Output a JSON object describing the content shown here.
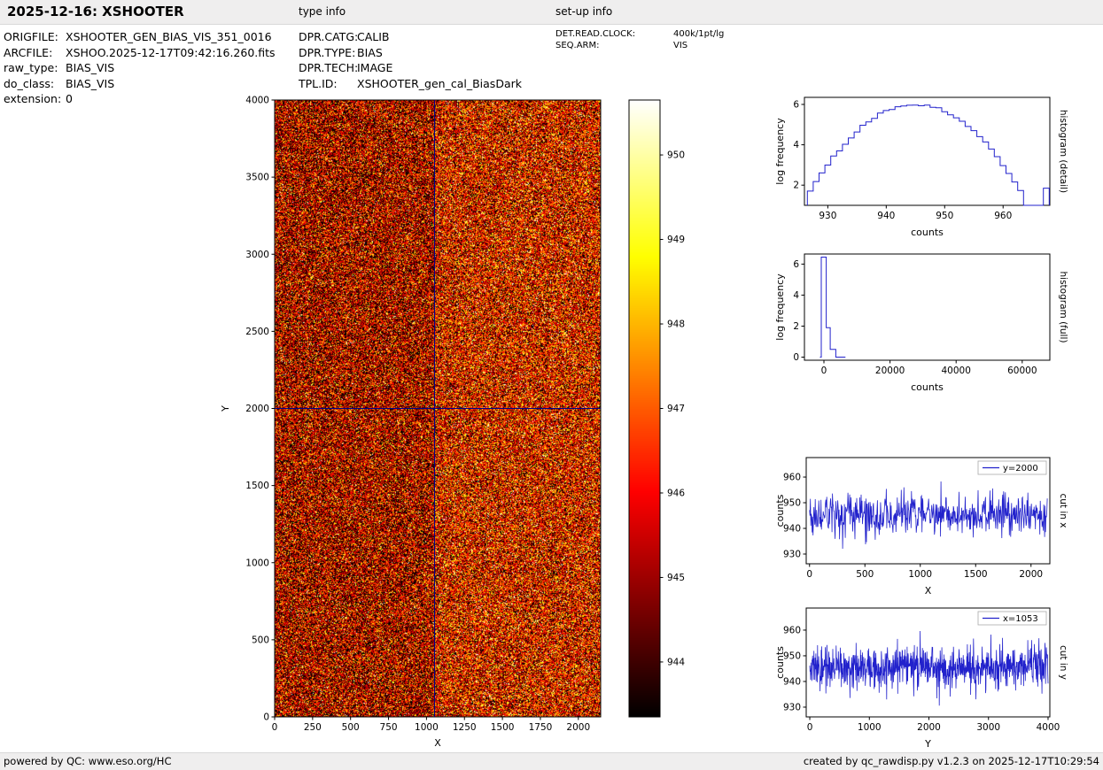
{
  "header": {
    "title": "2025-12-16: XSHOOTER",
    "type_info_label": "type info",
    "setup_info_label": "set-up info"
  },
  "file_info": {
    "rows": [
      {
        "label": "ORIGFILE:",
        "value": "XSHOOTER_GEN_BIAS_VIS_351_0016"
      },
      {
        "label": "ARCFILE:",
        "value": "XSHOO.2025-12-17T09:42:16.260.fits"
      },
      {
        "label": "raw_type:",
        "value": "BIAS_VIS"
      },
      {
        "label": "do_class:",
        "value": "BIAS_VIS"
      },
      {
        "label": "extension:",
        "value": "0"
      }
    ]
  },
  "type_info": {
    "rows": [
      {
        "label": "DPR.CATG:",
        "value": "CALIB"
      },
      {
        "label": "DPR.TYPE:",
        "value": "BIAS"
      },
      {
        "label": "DPR.TECH:",
        "value": "IMAGE"
      },
      {
        "label": "TPL.ID:",
        "value": "XSHOOTER_gen_cal_BiasDark"
      }
    ]
  },
  "setup_info": {
    "rows": [
      {
        "label": "DET.READ.CLOCK:",
        "value": "400k/1pt/lg"
      },
      {
        "label": "SEQ.ARM:",
        "value": "VIS"
      }
    ]
  },
  "footer": {
    "left_prefix": "powered by QC: ",
    "left_link": "www.eso.org/HC",
    "right": "created by qc_rawdisp.py v1.2.3 on 2025-12-17T10:29:54"
  },
  "chart_data": [
    {
      "id": "bias_image",
      "type": "heatmap",
      "xlabel": "X",
      "ylabel": "Y",
      "xlim": [
        0,
        2147
      ],
      "ylim": [
        0,
        4000
      ],
      "xticks": [
        0,
        250,
        500,
        750,
        1000,
        1250,
        1500,
        1750,
        2000
      ],
      "yticks": [
        0,
        500,
        1000,
        1500,
        2000,
        2500,
        3000,
        3500,
        4000
      ],
      "colormap": "hot",
      "mean_counts": 945.5,
      "sigma_counts": 2.0,
      "crosshair_x": 1053,
      "crosshair_y": 2000,
      "crosshair_color": "#00008b",
      "colorbar": {
        "ticks": [
          944,
          945,
          946,
          947,
          948,
          949,
          950
        ],
        "vmin": 943.35,
        "vmax": 950.65
      }
    },
    {
      "id": "histogram_detail",
      "type": "step-histogram",
      "xlabel": "counts",
      "ylabel": "log frequency",
      "side_label": "histogram (detail)",
      "xlim": [
        926,
        968
      ],
      "ylim": [
        1,
        6.35
      ],
      "xticks": [
        930,
        940,
        950,
        960
      ],
      "yticks": [
        2,
        4,
        6
      ],
      "peak": {
        "x": 945,
        "log_freq": 6
      },
      "sigma": 4.04,
      "bin_width": 1,
      "line_color": "#2222cc"
    },
    {
      "id": "histogram_full",
      "type": "step-histogram",
      "xlabel": "counts",
      "ylabel": "log frequency",
      "side_label": "histogram (full)",
      "xlim": [
        -5900,
        68360
      ],
      "ylim": [
        -0.2,
        6.65
      ],
      "xticks": [
        0,
        20000,
        40000,
        60000
      ],
      "yticks": [
        0,
        2,
        4,
        6
      ],
      "path": [
        [
          -1200,
          0
        ],
        [
          -800,
          0
        ],
        [
          -800,
          6.45
        ],
        [
          700,
          6.45
        ],
        [
          700,
          1.9
        ],
        [
          1900,
          1.9
        ],
        [
          1900,
          0.5
        ],
        [
          3600,
          0.5
        ],
        [
          3600,
          0
        ],
        [
          6500,
          0
        ]
      ],
      "line_color": "#2222cc"
    },
    {
      "id": "cut_in_x",
      "type": "line",
      "legend": "y=2000",
      "side_label": "cut in x",
      "xlabel": "X",
      "ylabel": "counts",
      "xlim": [
        -30,
        2170
      ],
      "ylim": [
        926.2,
        967.6
      ],
      "xticks": [
        0,
        500,
        1000,
        1500,
        2000
      ],
      "yticks": [
        930,
        940,
        950,
        960
      ],
      "series_mean": 945.3,
      "series_sigma": 4.2,
      "n_points": 540,
      "x_data_max": 2147,
      "line_color": "#2222cc"
    },
    {
      "id": "cut_in_y",
      "type": "line",
      "legend": "x=1053",
      "side_label": "cut in y",
      "xlabel": "Y",
      "ylabel": "counts",
      "xlim": [
        -60,
        4030
      ],
      "ylim": [
        926.2,
        968.6
      ],
      "xticks": [
        0,
        1000,
        2000,
        3000,
        4000
      ],
      "yticks": [
        930,
        940,
        950,
        960
      ],
      "series_mean": 945.5,
      "series_sigma": 4.2,
      "n_points": 860,
      "x_data_max": 4000,
      "line_color": "#2222cc"
    }
  ]
}
